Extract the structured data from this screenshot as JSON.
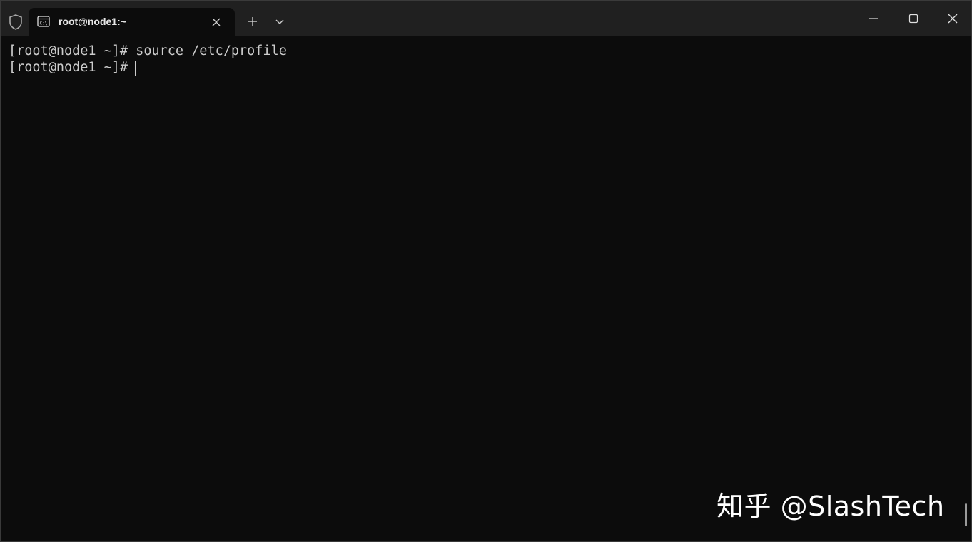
{
  "tab": {
    "title": "root@node1:~",
    "icon": "terminal-cmd-icon"
  },
  "titlebar": {
    "shield_icon": "shield-icon",
    "new_tab_icon": "plus-icon",
    "dropdown_icon": "chevron-down-icon",
    "minimize_icon": "minimize-icon",
    "maximize_icon": "maximize-icon",
    "close_icon": "close-icon"
  },
  "terminal": {
    "lines": [
      "[root@node1 ~]# source /etc/profile",
      "[root@node1 ~]# "
    ]
  },
  "watermark": {
    "text": "知乎 @SlashTech"
  },
  "colors": {
    "background": "#0c0c0c",
    "titlebar": "#202020",
    "text": "#cccccc"
  }
}
